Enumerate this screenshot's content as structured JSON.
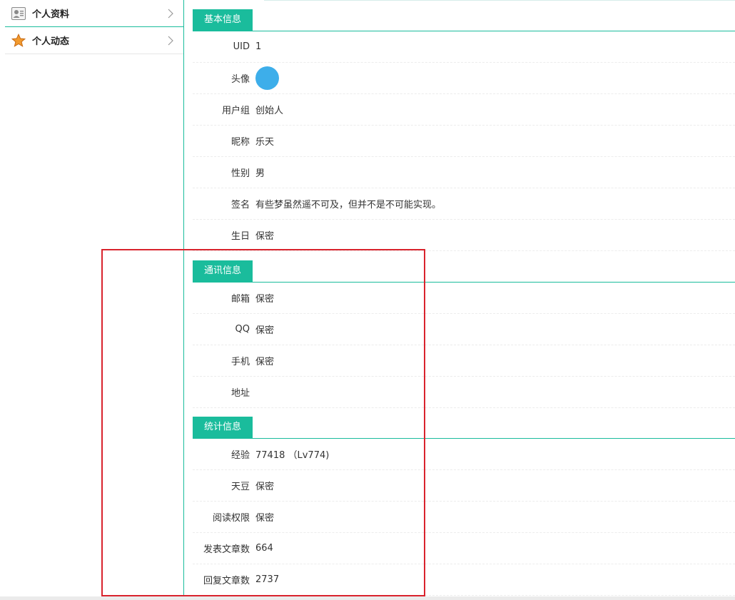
{
  "sidebar": {
    "items": [
      {
        "label": "个人资料",
        "icon": "profile-card-icon"
      },
      {
        "label": "个人动态",
        "icon": "star-icon"
      }
    ]
  },
  "sections": {
    "basic": {
      "title": "基本信息",
      "rows": [
        {
          "key": "UID",
          "value": "1"
        },
        {
          "key": "头像",
          "value": ""
        },
        {
          "key": "用户组",
          "value": "创始人"
        },
        {
          "key": "昵称",
          "value": "乐天"
        },
        {
          "key": "性别",
          "value": "男"
        },
        {
          "key": "签名",
          "value": "有些梦虽然遥不可及，但并不是不可能实现。"
        },
        {
          "key": "生日",
          "value": "保密"
        }
      ]
    },
    "contact": {
      "title": "通讯信息",
      "rows": [
        {
          "key": "邮箱",
          "value": "保密"
        },
        {
          "key": "QQ",
          "value": "保密"
        },
        {
          "key": "手机",
          "value": "保密"
        },
        {
          "key": "地址",
          "value": ""
        }
      ]
    },
    "stats": {
      "title": "统计信息",
      "rows": [
        {
          "key": "经验",
          "value": "77418 （Lv774)"
        },
        {
          "key": "天豆",
          "value": "保密"
        },
        {
          "key": "阅读权限",
          "value": "保密"
        },
        {
          "key": "发表文章数",
          "value": "664"
        },
        {
          "key": "回复文章数",
          "value": "2737"
        }
      ]
    }
  },
  "colors": {
    "accent": "#1abc9c",
    "avatar": "#3daeea",
    "highlight": "#d9232d"
  }
}
